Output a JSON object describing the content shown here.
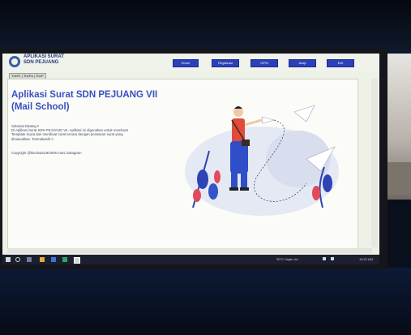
{
  "app": {
    "title_line1": "APLIKASI SURAT",
    "title_line2": "SDN PEJUANG"
  },
  "nav": [
    "Home",
    "Registrasi",
    "OPSI",
    "Arsip",
    "Exit"
  ],
  "tabs": "TheP1 | ThePa | TheP",
  "main": {
    "headline_line1": "Aplikasi Surat SDN PEJUANG VII",
    "headline_line2": "(Mail School)",
    "para_line1": "Selamat Datang !!",
    "para_line2": "Di Aplikasi Surat SDN PEJUANG VII. Aplikasi ini digunakan untuk membuat",
    "para_line3": "Template Surat dan membuat surat secara dengan peraturan surat yang",
    "para_line4": "dimasukkan. Terimakasih !!",
    "copyright": "Copyright @ikonisasi19/2006 mani instagram"
  },
  "taskbar": {
    "weather": "30°C Hujan rin...",
    "time": "10:22 AM"
  },
  "colors": {
    "accent": "#3a4fc2",
    "nav_button": "#2b40b8",
    "screen_bg": "#fbfcf7"
  }
}
